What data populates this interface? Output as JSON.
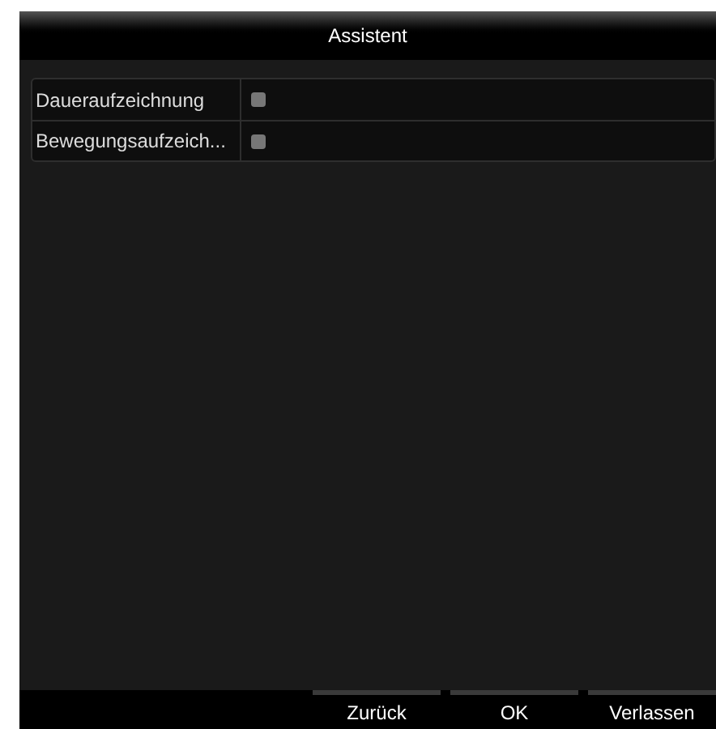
{
  "window": {
    "title": "Assistent"
  },
  "rows": [
    {
      "label": "Daueraufzeichnung",
      "checked": false
    },
    {
      "label": "Bewegungsaufzeich...",
      "checked": false
    }
  ],
  "buttons": [
    "Zurück",
    "OK",
    "Verlassen"
  ]
}
